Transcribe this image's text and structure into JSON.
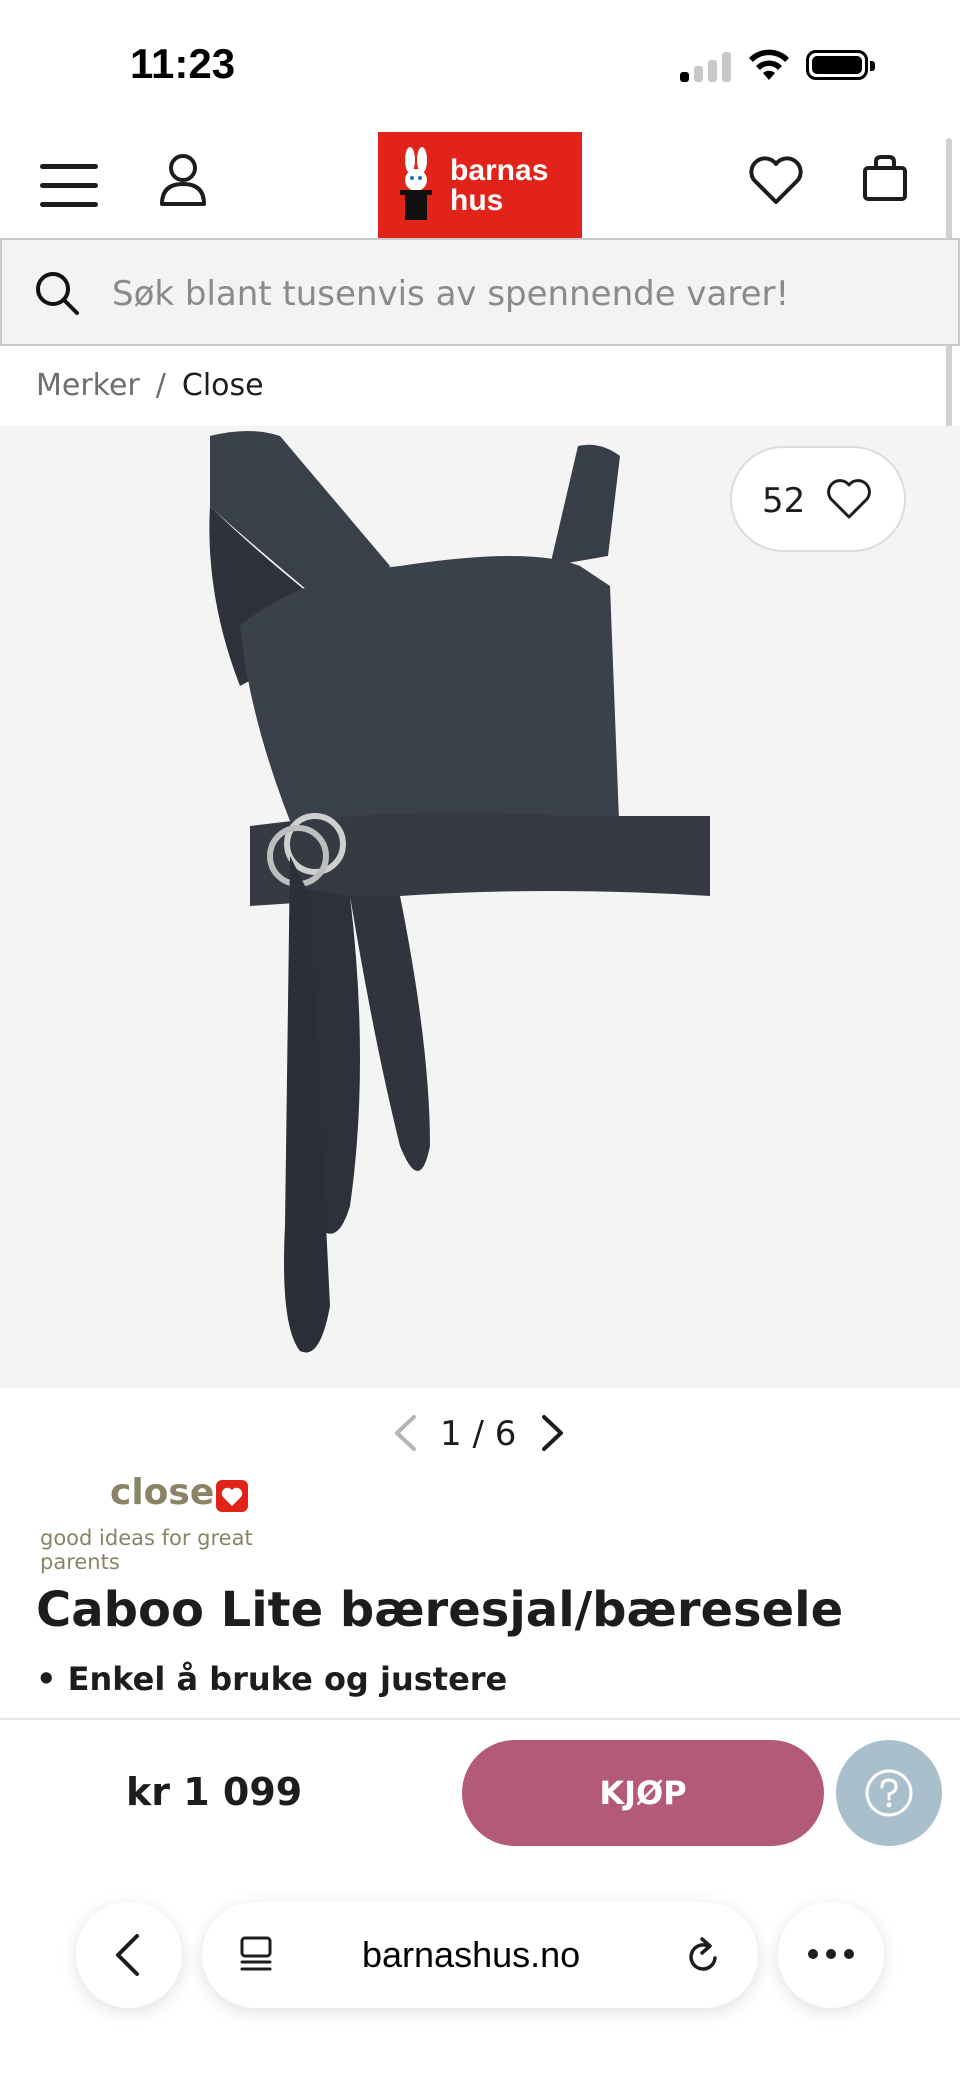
{
  "status_bar": {
    "time": "11:23"
  },
  "header": {
    "logo_line1": "barnas",
    "logo_line2": "hus"
  },
  "search": {
    "placeholder": "Søk blant tusenvis av spennende varer!"
  },
  "breadcrumb": {
    "root": "Merker",
    "separator": "/",
    "current": "Close"
  },
  "gallery": {
    "favorites_count": "52",
    "pager": "1 / 6"
  },
  "brand": {
    "name": "close",
    "tagline": "good ideas for great parents"
  },
  "product": {
    "title": "Caboo Lite bæresjal/bæresele",
    "bullet": "• Enkel å bruke og justere",
    "price": "kr 1 099",
    "buy_label": "KJØP"
  },
  "browser": {
    "url": "barnashus.no"
  },
  "colors": {
    "brand_red": "#e2231a",
    "buy_button": "#b25a78",
    "help_button": "#a9bfcb"
  }
}
